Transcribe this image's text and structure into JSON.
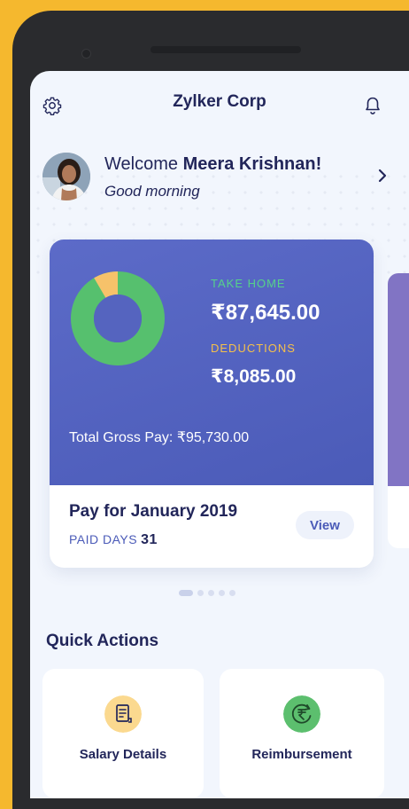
{
  "header": {
    "title": "Zylker Corp",
    "settings_icon": "gear-icon",
    "notifications_icon": "bell-icon"
  },
  "welcome": {
    "prefix": "Welcome",
    "name": "Meera Krishnan!",
    "greeting": "Good morning"
  },
  "pay_card": {
    "take_home_label": "TAKE HOME",
    "take_home_value": "₹87,645.00",
    "deductions_label": "DEDUCTIONS",
    "deductions_value": "₹8,085.00",
    "gross_pay": "Total Gross Pay: ₹95,730.00",
    "period": "Pay for January 2019",
    "paid_days_label": "PAID DAYS",
    "paid_days_value": "31",
    "view_label": "View",
    "donut": {
      "take_home": 87645,
      "deductions": 8085
    },
    "colors": {
      "take_home": "#56c06e",
      "deductions": "#f6c26a",
      "card_bg": "#5060BE"
    }
  },
  "pager": {
    "count": 5,
    "active": 0
  },
  "quick_actions": {
    "title": "Quick Actions",
    "items": [
      {
        "label": "Salary Details",
        "icon": "document-icon"
      },
      {
        "label": "Reimbursement",
        "icon": "rupee-refresh-icon"
      }
    ]
  }
}
